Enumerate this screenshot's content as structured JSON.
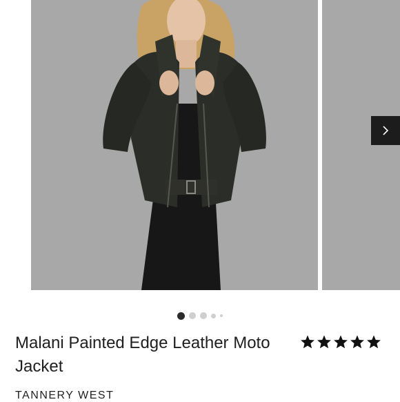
{
  "product": {
    "title": "Malani Painted Edge Leather Moto Jacket",
    "brand": "TANNERY WEST",
    "rating": 5,
    "rating_max": 5
  },
  "carousel": {
    "total_images": 5,
    "active_index": 0,
    "next_icon": "chevron-right-icon"
  },
  "colors": {
    "image_bg": "#a8a8a8",
    "button_bg": "#1c1c1c",
    "dot_active": "#2a2a2a",
    "dot_inactive": "#cfcfcf"
  }
}
